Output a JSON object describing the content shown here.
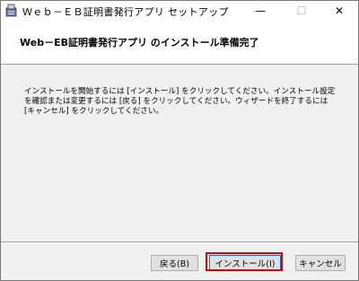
{
  "window": {
    "title": "Ｗｅｂ－ＥＢ証明書発行アプリ セットアップ"
  },
  "titlebar": {
    "minimize": "—",
    "maximize": "☐",
    "close": "✕"
  },
  "header": {
    "title": "Web－EB証明書発行アプリ のインストール準備完了"
  },
  "body": {
    "text": "インストールを開始するには [インストール] をクリックしてください。インストール設定を確認または変更するには [戻る] をクリックしてください。ウィザードを終了するには [キャンセル] をクリックしてください。"
  },
  "buttons": {
    "back": "戻る(B)",
    "install": "インストール(I)",
    "cancel": "キャンセル"
  },
  "colors": {
    "highlight": "#e00000",
    "focus_border": "#0078d7"
  }
}
